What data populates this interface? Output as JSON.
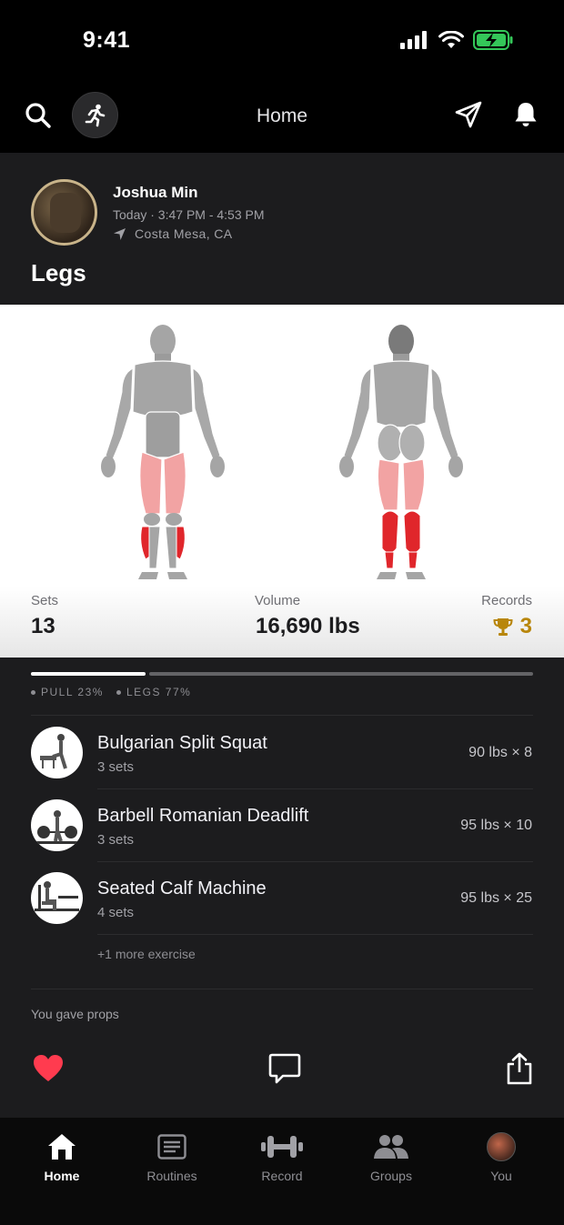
{
  "status_bar": {
    "time": "9:41"
  },
  "header": {
    "title": "Home"
  },
  "post": {
    "user_name": "Joshua Min",
    "time_range": "Today · 3:47 PM - 4:53 PM",
    "location": "Costa Mesa, CA",
    "workout_title": "Legs",
    "stats": {
      "sets_label": "Sets",
      "sets_value": "13",
      "volume_label": "Volume",
      "volume_value": "16,690 lbs",
      "records_label": "Records",
      "records_value": "3"
    },
    "muscle_split": [
      {
        "label": "PULL 23%",
        "fraction": 0.23
      },
      {
        "label": "LEGS 77%",
        "fraction": 0.77
      }
    ],
    "exercises": [
      {
        "name": "Bulgarian Split Squat",
        "sets": "3 sets",
        "best": "90 lbs × 8"
      },
      {
        "name": "Barbell Romanian Deadlift",
        "sets": "3 sets",
        "best": "95 lbs × 10"
      },
      {
        "name": "Seated Calf Machine",
        "sets": "4 sets",
        "best": "95 lbs × 25"
      }
    ],
    "more_exercises": "+1 more exercise",
    "props_text": "You gave props"
  },
  "tabbar": {
    "home": "Home",
    "routines": "Routines",
    "record": "Record",
    "groups": "Groups",
    "you": "You"
  },
  "colors": {
    "accent_gold": "#b8860b",
    "like_red": "#ff3b4f",
    "muscle_primary": "#e0262b",
    "muscle_secondary": "#f2a3a3"
  }
}
